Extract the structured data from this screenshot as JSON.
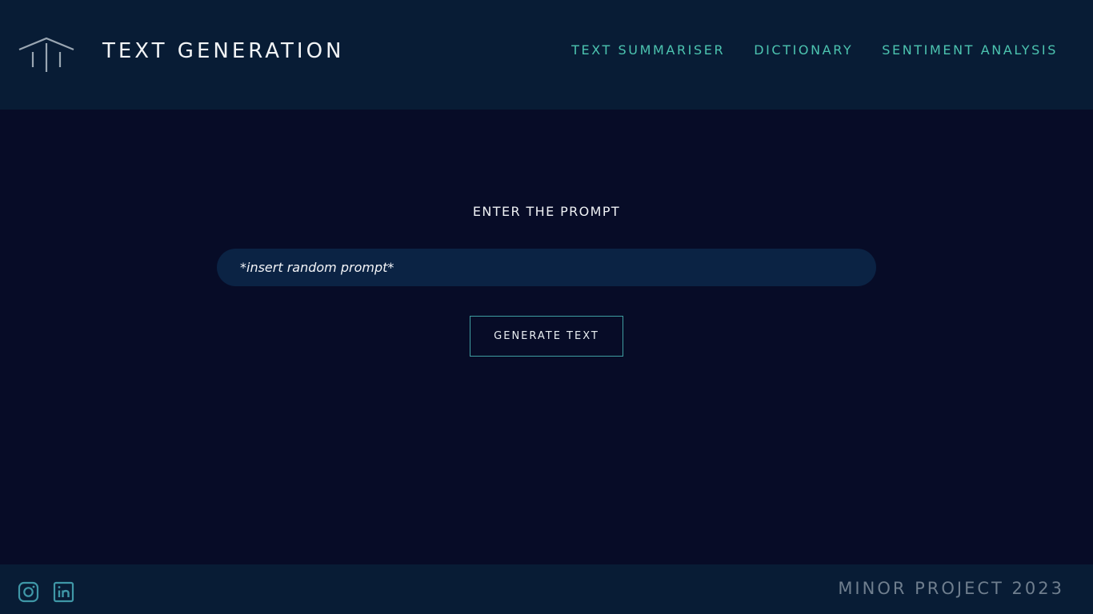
{
  "header": {
    "title": "TEXT GENERATION",
    "logo_icon": "pillar-logo-icon",
    "nav": [
      {
        "label": "TEXT SUMMARISER"
      },
      {
        "label": "DICTIONARY"
      },
      {
        "label": "SENTIMENT ANALYSIS"
      }
    ]
  },
  "main": {
    "prompt_label": "ENTER THE PROMPT",
    "prompt_placeholder": "*insert random prompt*",
    "generate_label": "GENERATE TEXT"
  },
  "footer": {
    "social_icons": [
      "instagram-icon",
      "linkedin-icon"
    ],
    "text": "MINOR PROJECT 2023"
  },
  "colors": {
    "background": "#070c27",
    "header_footer": "#081c35",
    "accent": "#4cc4b0",
    "input_bg": "#0b2344"
  }
}
